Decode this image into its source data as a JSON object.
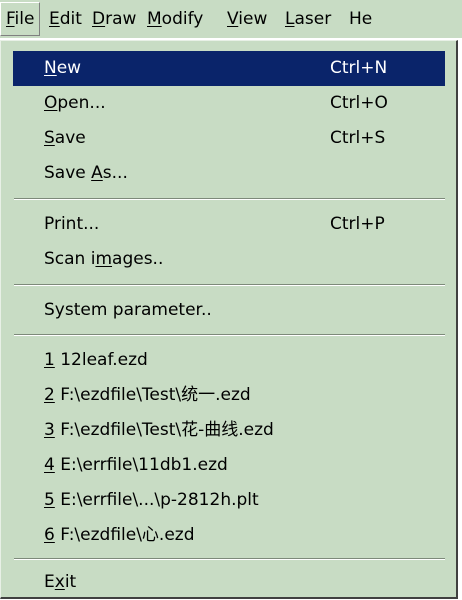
{
  "menubar": [
    {
      "pre": "",
      "key": "F",
      "post": "ile"
    },
    {
      "pre": "",
      "key": "E",
      "post": "dit"
    },
    {
      "pre": "",
      "key": "D",
      "post": "raw"
    },
    {
      "pre": "",
      "key": "M",
      "post": "odify"
    },
    {
      "pre": "",
      "key": "V",
      "post": "iew"
    },
    {
      "pre": "",
      "key": "L",
      "post": "aser"
    },
    {
      "pre": "H",
      "key": "",
      "post": "e"
    }
  ],
  "file_menu": {
    "new": {
      "pre": "",
      "key": "N",
      "post": "ew",
      "shortcut": "Ctrl+N"
    },
    "open": {
      "pre": "",
      "key": "O",
      "post": "pen...",
      "shortcut": "Ctrl+O"
    },
    "save": {
      "pre": "",
      "key": "S",
      "post": "ave",
      "shortcut": "Ctrl+S"
    },
    "save_as": {
      "pre": "Save ",
      "key": "A",
      "post": "s..."
    },
    "print": {
      "pre": "Print...",
      "key": "",
      "post": "",
      "shortcut": "Ctrl+P"
    },
    "scan": {
      "pre": "Scan i",
      "key": "m",
      "post": "ages.."
    },
    "sysparam": {
      "pre": "System parameter..",
      "key": "",
      "post": ""
    },
    "recent": [
      {
        "key": "1",
        "post": " 12leaf.ezd"
      },
      {
        "key": "2",
        "post": " F:\\ezdfile\\Test\\统一.ezd"
      },
      {
        "key": "3",
        "post": " F:\\ezdfile\\Test\\花-曲线.ezd"
      },
      {
        "key": "4",
        "post": " E:\\errfile\\11db1.ezd"
      },
      {
        "key": "5",
        "post": " E:\\errfile\\...\\p-2812h.plt"
      },
      {
        "key": "6",
        "post": " F:\\ezdfile\\心.ezd"
      }
    ],
    "exit": {
      "pre": "E",
      "key": "x",
      "post": "it"
    }
  }
}
